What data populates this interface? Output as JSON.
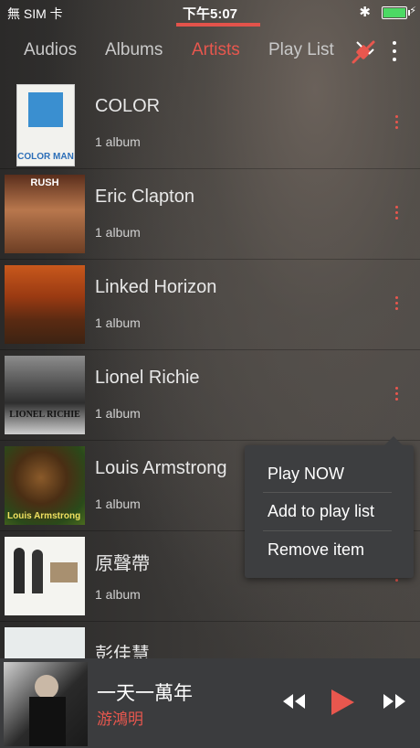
{
  "status": {
    "carrier": "無 SIM 卡",
    "time": "下午5:07",
    "bluetooth_icon": "bluetooth-icon",
    "battery_icon": "battery-charging-icon"
  },
  "tabs": [
    {
      "label": "Audios",
      "active": false
    },
    {
      "label": "Albums",
      "active": false
    },
    {
      "label": "Artists",
      "active": true
    },
    {
      "label": "Play List",
      "active": false
    }
  ],
  "accent_color": "#e8574e",
  "artists": [
    {
      "name": "COLOR",
      "count": "1 album",
      "art_text": "COLOR MAN"
    },
    {
      "name": "Eric Clapton",
      "count": "1 album",
      "art_text": "RUSH"
    },
    {
      "name": "Linked Horizon",
      "count": "1 album",
      "art_text": ""
    },
    {
      "name": "Lionel Richie",
      "count": "1 album",
      "art_text": "LIONEL RICHIE"
    },
    {
      "name": "Louis Armstrong",
      "count": "1 album",
      "art_text": "Louis Armstrong"
    },
    {
      "name": "原聲帶",
      "count": "1 album",
      "art_text": ""
    },
    {
      "name": "彭佳慧",
      "count": "",
      "art_text": ""
    }
  ],
  "context_menu": {
    "items": [
      "Play NOW",
      "Add to play list",
      "Remove item"
    ]
  },
  "now_playing": {
    "title": "一天一萬年",
    "artist": "游鴻明"
  }
}
